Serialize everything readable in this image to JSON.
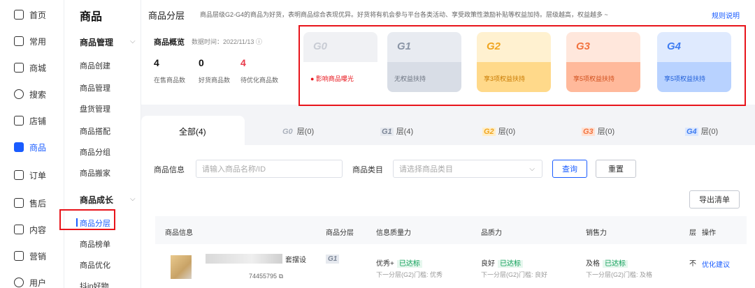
{
  "nav": {
    "items": [
      {
        "label": "首页",
        "icon": "home-icon"
      },
      {
        "label": "常用",
        "icon": "folder-icon"
      },
      {
        "label": "商城",
        "icon": "house-icon"
      },
      {
        "label": "搜索",
        "icon": "search-icon"
      },
      {
        "label": "店铺",
        "icon": "store-icon"
      },
      {
        "label": "商品",
        "icon": "bag-icon"
      },
      {
        "label": "订单",
        "icon": "order-icon"
      },
      {
        "label": "售后",
        "icon": "aftersale-icon"
      },
      {
        "label": "内容",
        "icon": "content-icon"
      },
      {
        "label": "营销",
        "icon": "megaphone-icon"
      },
      {
        "label": "用户",
        "icon": "user-icon"
      }
    ],
    "active_index": 5
  },
  "submenu": {
    "title": "商品",
    "group1": "商品管理",
    "group1_items": [
      "商品创建",
      "商品管理",
      "盘货管理",
      "商品搭配",
      "商品分组",
      "商品搬家"
    ],
    "group2": "商品成长",
    "group2_items": [
      "商品分层",
      "商品榜单",
      "商品优化",
      "抖in好物"
    ]
  },
  "header": {
    "title": "商品分层",
    "desc": "商品层级G2-G4的商品为好货，表明商品综合表现优异。好货将有机会参与平台各类活动、享受政策性激励补贴等权益加持。层级越高，权益越多 ~",
    "rule_link": "规则说明"
  },
  "overview": {
    "title": "商品概览",
    "time": "数据时间：2022/11/13 ⓘ",
    "stats": [
      {
        "value": "4",
        "label": "在售商品数"
      },
      {
        "value": "0",
        "label": "好货商品数"
      },
      {
        "value": "4",
        "label": "待优化商品数"
      }
    ]
  },
  "tiers": [
    {
      "code": "G0",
      "text": "● 影响商品曝光"
    },
    {
      "code": "G1",
      "text": "无权益扶持"
    },
    {
      "code": "G2",
      "text": "享3项权益扶持"
    },
    {
      "code": "G3",
      "text": "享5项权益扶持"
    },
    {
      "code": "G4",
      "text": "享5项权益扶持"
    }
  ],
  "tabs": {
    "all": "全部(4)",
    "items": [
      {
        "code": "G0",
        "label": "层(0)"
      },
      {
        "code": "G1",
        "label": "层(4)"
      },
      {
        "code": "G2",
        "label": "层(0)"
      },
      {
        "code": "G3",
        "label": "层(0)"
      },
      {
        "code": "G4",
        "label": "层(0)"
      }
    ]
  },
  "filters": {
    "info_label": "商品信息",
    "info_placeholder": "请输入商品名称/ID",
    "category_label": "商品类目",
    "category_placeholder": "请选择商品类目",
    "query": "查询",
    "reset": "重置",
    "export": "导出清单"
  },
  "table": {
    "headers": [
      "商品信息",
      "商品分层",
      "信息质量力",
      "品质力",
      "销售力",
      "层",
      "操作"
    ],
    "row": {
      "name_fragment": "套摆设",
      "id_fragment": "74455795",
      "tier": "G1",
      "info_quality": "优秀+",
      "info_tag": "已达标",
      "info_sub": "下一分层(G2)门槛: 优秀",
      "quality": "良好",
      "quality_tag": "已达标",
      "quality_sub": "下一分层(G2)门槛: 良好",
      "sales": "及格",
      "sales_tag": "已达标",
      "sales_sub": "下一分层(G2)门槛: 及格",
      "cut": "不",
      "action": "优化建议"
    }
  },
  "colors": {
    "accent": "#1a5cff",
    "highlight_border": "#e8141b",
    "warn": "#e83a4a",
    "ok": "#13a05b"
  }
}
